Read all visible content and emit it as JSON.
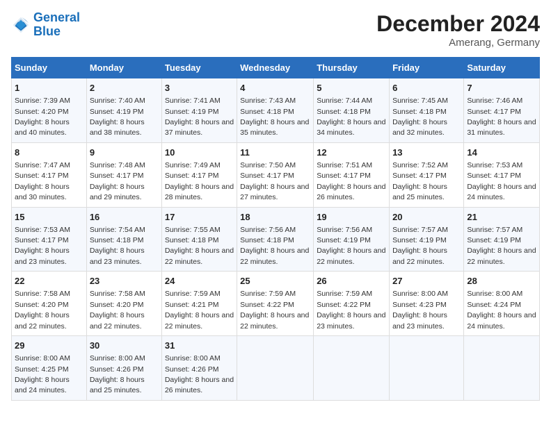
{
  "header": {
    "logo_line1": "General",
    "logo_line2": "Blue",
    "month_year": "December 2024",
    "location": "Amerang, Germany"
  },
  "days_of_week": [
    "Sunday",
    "Monday",
    "Tuesday",
    "Wednesday",
    "Thursday",
    "Friday",
    "Saturday"
  ],
  "weeks": [
    [
      {
        "day": "1",
        "sunrise": "Sunrise: 7:39 AM",
        "sunset": "Sunset: 4:20 PM",
        "daylight": "Daylight: 8 hours and 40 minutes."
      },
      {
        "day": "2",
        "sunrise": "Sunrise: 7:40 AM",
        "sunset": "Sunset: 4:19 PM",
        "daylight": "Daylight: 8 hours and 38 minutes."
      },
      {
        "day": "3",
        "sunrise": "Sunrise: 7:41 AM",
        "sunset": "Sunset: 4:19 PM",
        "daylight": "Daylight: 8 hours and 37 minutes."
      },
      {
        "day": "4",
        "sunrise": "Sunrise: 7:43 AM",
        "sunset": "Sunset: 4:18 PM",
        "daylight": "Daylight: 8 hours and 35 minutes."
      },
      {
        "day": "5",
        "sunrise": "Sunrise: 7:44 AM",
        "sunset": "Sunset: 4:18 PM",
        "daylight": "Daylight: 8 hours and 34 minutes."
      },
      {
        "day": "6",
        "sunrise": "Sunrise: 7:45 AM",
        "sunset": "Sunset: 4:18 PM",
        "daylight": "Daylight: 8 hours and 32 minutes."
      },
      {
        "day": "7",
        "sunrise": "Sunrise: 7:46 AM",
        "sunset": "Sunset: 4:17 PM",
        "daylight": "Daylight: 8 hours and 31 minutes."
      }
    ],
    [
      {
        "day": "8",
        "sunrise": "Sunrise: 7:47 AM",
        "sunset": "Sunset: 4:17 PM",
        "daylight": "Daylight: 8 hours and 30 minutes."
      },
      {
        "day": "9",
        "sunrise": "Sunrise: 7:48 AM",
        "sunset": "Sunset: 4:17 PM",
        "daylight": "Daylight: 8 hours and 29 minutes."
      },
      {
        "day": "10",
        "sunrise": "Sunrise: 7:49 AM",
        "sunset": "Sunset: 4:17 PM",
        "daylight": "Daylight: 8 hours and 28 minutes."
      },
      {
        "day": "11",
        "sunrise": "Sunrise: 7:50 AM",
        "sunset": "Sunset: 4:17 PM",
        "daylight": "Daylight: 8 hours and 27 minutes."
      },
      {
        "day": "12",
        "sunrise": "Sunrise: 7:51 AM",
        "sunset": "Sunset: 4:17 PM",
        "daylight": "Daylight: 8 hours and 26 minutes."
      },
      {
        "day": "13",
        "sunrise": "Sunrise: 7:52 AM",
        "sunset": "Sunset: 4:17 PM",
        "daylight": "Daylight: 8 hours and 25 minutes."
      },
      {
        "day": "14",
        "sunrise": "Sunrise: 7:53 AM",
        "sunset": "Sunset: 4:17 PM",
        "daylight": "Daylight: 8 hours and 24 minutes."
      }
    ],
    [
      {
        "day": "15",
        "sunrise": "Sunrise: 7:53 AM",
        "sunset": "Sunset: 4:17 PM",
        "daylight": "Daylight: 8 hours and 23 minutes."
      },
      {
        "day": "16",
        "sunrise": "Sunrise: 7:54 AM",
        "sunset": "Sunset: 4:18 PM",
        "daylight": "Daylight: 8 hours and 23 minutes."
      },
      {
        "day": "17",
        "sunrise": "Sunrise: 7:55 AM",
        "sunset": "Sunset: 4:18 PM",
        "daylight": "Daylight: 8 hours and 22 minutes."
      },
      {
        "day": "18",
        "sunrise": "Sunrise: 7:56 AM",
        "sunset": "Sunset: 4:18 PM",
        "daylight": "Daylight: 8 hours and 22 minutes."
      },
      {
        "day": "19",
        "sunrise": "Sunrise: 7:56 AM",
        "sunset": "Sunset: 4:19 PM",
        "daylight": "Daylight: 8 hours and 22 minutes."
      },
      {
        "day": "20",
        "sunrise": "Sunrise: 7:57 AM",
        "sunset": "Sunset: 4:19 PM",
        "daylight": "Daylight: 8 hours and 22 minutes."
      },
      {
        "day": "21",
        "sunrise": "Sunrise: 7:57 AM",
        "sunset": "Sunset: 4:19 PM",
        "daylight": "Daylight: 8 hours and 22 minutes."
      }
    ],
    [
      {
        "day": "22",
        "sunrise": "Sunrise: 7:58 AM",
        "sunset": "Sunset: 4:20 PM",
        "daylight": "Daylight: 8 hours and 22 minutes."
      },
      {
        "day": "23",
        "sunrise": "Sunrise: 7:58 AM",
        "sunset": "Sunset: 4:20 PM",
        "daylight": "Daylight: 8 hours and 22 minutes."
      },
      {
        "day": "24",
        "sunrise": "Sunrise: 7:59 AM",
        "sunset": "Sunset: 4:21 PM",
        "daylight": "Daylight: 8 hours and 22 minutes."
      },
      {
        "day": "25",
        "sunrise": "Sunrise: 7:59 AM",
        "sunset": "Sunset: 4:22 PM",
        "daylight": "Daylight: 8 hours and 22 minutes."
      },
      {
        "day": "26",
        "sunrise": "Sunrise: 7:59 AM",
        "sunset": "Sunset: 4:22 PM",
        "daylight": "Daylight: 8 hours and 23 minutes."
      },
      {
        "day": "27",
        "sunrise": "Sunrise: 8:00 AM",
        "sunset": "Sunset: 4:23 PM",
        "daylight": "Daylight: 8 hours and 23 minutes."
      },
      {
        "day": "28",
        "sunrise": "Sunrise: 8:00 AM",
        "sunset": "Sunset: 4:24 PM",
        "daylight": "Daylight: 8 hours and 24 minutes."
      }
    ],
    [
      {
        "day": "29",
        "sunrise": "Sunrise: 8:00 AM",
        "sunset": "Sunset: 4:25 PM",
        "daylight": "Daylight: 8 hours and 24 minutes."
      },
      {
        "day": "30",
        "sunrise": "Sunrise: 8:00 AM",
        "sunset": "Sunset: 4:26 PM",
        "daylight": "Daylight: 8 hours and 25 minutes."
      },
      {
        "day": "31",
        "sunrise": "Sunrise: 8:00 AM",
        "sunset": "Sunset: 4:26 PM",
        "daylight": "Daylight: 8 hours and 26 minutes."
      },
      null,
      null,
      null,
      null
    ]
  ]
}
